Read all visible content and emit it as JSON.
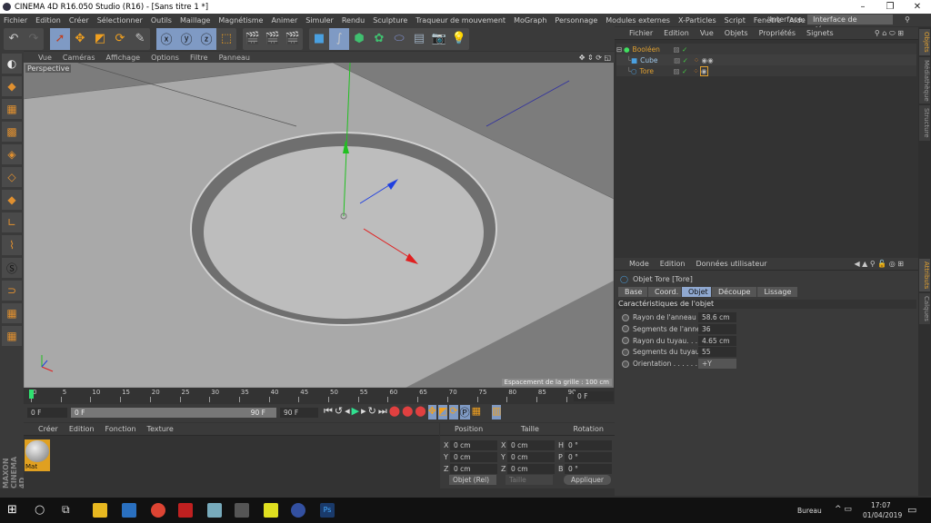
{
  "window": {
    "title": "CINEMA 4D R16.050 Studio (R16) - [Sans titre 1 *]"
  },
  "menu": [
    "Fichier",
    "Edition",
    "Créer",
    "Sélectionner",
    "Outils",
    "Maillage",
    "Magnétisme",
    "Animer",
    "Simuler",
    "Rendu",
    "Sculpture",
    "Traqueur de mouvement",
    "MoGraph",
    "Personnage",
    "Modules externes",
    "X-Particles",
    "Script",
    "Fenêtre",
    "Aide"
  ],
  "interface": {
    "label": "Interface:",
    "value": "Interface de démarrage"
  },
  "viewport": {
    "menu": [
      "Vue",
      "Caméras",
      "Affichage",
      "Options",
      "Filtre",
      "Panneau"
    ],
    "camera": "Perspective",
    "grid_label": "Espacement de la grille : 100 cm"
  },
  "timeline": {
    "ticks": [
      "0",
      "5",
      "10",
      "15",
      "20",
      "25",
      "30",
      "35",
      "40",
      "45",
      "50",
      "55",
      "60",
      "65",
      "70",
      "75",
      "80",
      "85",
      "90"
    ],
    "current": "0 F",
    "start": "0 F",
    "range_start": "0 F",
    "range_end": "90 F",
    "end": "90 F"
  },
  "materials": {
    "menu": [
      "Créer",
      "Edition",
      "Fonction",
      "Texture"
    ],
    "items": [
      {
        "name": "Mat"
      }
    ]
  },
  "coords": {
    "headers": [
      "Position",
      "Taille",
      "Rotation"
    ],
    "rows": [
      [
        "X",
        "0 cm",
        "X",
        "0 cm",
        "H",
        "0 °"
      ],
      [
        "Y",
        "0 cm",
        "Y",
        "0 cm",
        "P",
        "0 °"
      ],
      [
        "Z",
        "0 cm",
        "Z",
        "0 cm",
        "B",
        "0 °"
      ]
    ],
    "mode": "Objet (Rel)",
    "size_mode": "Taille",
    "apply": "Appliquer"
  },
  "objects": {
    "menu": [
      "Fichier",
      "Edition",
      "Vue",
      "Objets",
      "Propriétés",
      "Signets"
    ],
    "items": [
      {
        "name": "Booléen",
        "color": "#e0a030"
      },
      {
        "name": "Cube",
        "color": "#9ec6e8"
      },
      {
        "name": "Tore",
        "color": "#e0a030"
      }
    ]
  },
  "attributes": {
    "menu": [
      "Mode",
      "Edition",
      "Données utilisateur"
    ],
    "object": "Objet Tore [Tore]",
    "tabs": [
      "Base",
      "Coord.",
      "Objet",
      "Découpe",
      "Lissage"
    ],
    "active_tab": "Objet",
    "section": "Caractéristiques de l'objet",
    "fields": [
      {
        "label": "Rayon de l'anneau . . .",
        "value": "58.6 cm"
      },
      {
        "label": "Segments de l'anneau",
        "value": "36"
      },
      {
        "label": "Rayon du tuyau. . . . . .",
        "value": "4.65 cm"
      },
      {
        "label": "Segments du tuyau. . .",
        "value": "55"
      },
      {
        "label": "Orientation . . . . . . . . .",
        "value": "+Y"
      }
    ]
  },
  "sidetabs": [
    "Objets",
    "Médiathèque",
    "Structure",
    "Attributs",
    "Calques"
  ],
  "brand": "MAXON CINEMA 4D",
  "taskbar": {
    "desktop": "Bureau",
    "time": "17:07",
    "date": "01/04/2019"
  }
}
